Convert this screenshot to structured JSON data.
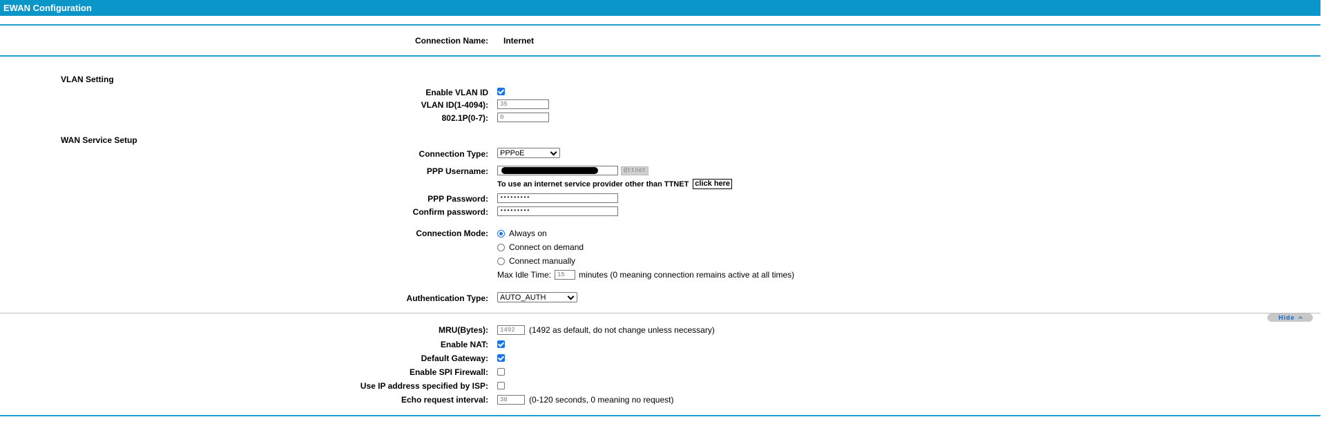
{
  "header": {
    "title": "EWAN Configuration"
  },
  "connection": {
    "name_label": "Connection Name:",
    "name_value": "Internet"
  },
  "vlan": {
    "section_title": "VLAN Setting",
    "enable_label": "Enable VLAN ID",
    "enable_checked": true,
    "id_label": "VLAN ID(1-4094):",
    "id_value": "35",
    "p_label": "802.1P(0-7):",
    "p_value": "0"
  },
  "wan": {
    "section_title": "WAN Service Setup",
    "type_label": "Connection Type:",
    "type_value": "PPPoE",
    "user_label": "PPP Username:",
    "user_suffix": "@ttnet",
    "isp_note": "To use an internet service provider other than TTNET",
    "click_here": "click here",
    "pass_label": "PPP Password:",
    "pass_value": "•••••••••",
    "confirm_label": "Confirm password:",
    "confirm_value": "•••••••••",
    "mode_label": "Connection Mode:",
    "mode_options": [
      "Always on",
      "Connect on demand",
      "Connect manually"
    ],
    "mode_selected": 0,
    "idle_label": "Max Idle Time:",
    "idle_value": "15",
    "idle_suffix": "minutes (0 meaning connection remains active at all times)",
    "auth_label": "Authentication Type:",
    "auth_value": "AUTO_AUTH"
  },
  "advanced": {
    "hide_label": "Hide",
    "mru_label": "MRU(Bytes):",
    "mru_value": "1492",
    "mru_note": "(1492 as default, do not change unless necessary)",
    "nat_label": "Enable NAT:",
    "nat_checked": true,
    "gw_label": "Default Gateway:",
    "gw_checked": true,
    "spi_label": "Enable SPI Firewall:",
    "spi_checked": false,
    "isp_ip_label": "Use IP address specified by ISP:",
    "isp_ip_checked": false,
    "echo_label": "Echo request interval:",
    "echo_value": "30",
    "echo_note": "(0-120 seconds, 0 meaning no request)"
  },
  "colors": {
    "header_bg": "#0a96c9",
    "rule": "#1d9fd1",
    "check_accent": "#1a73e8"
  }
}
